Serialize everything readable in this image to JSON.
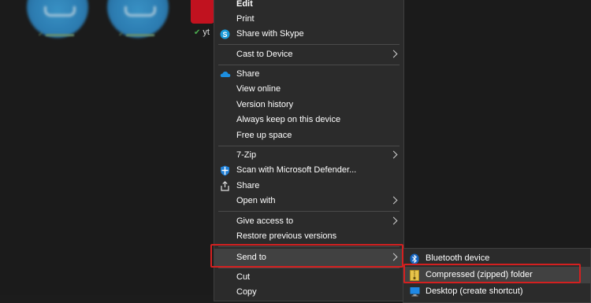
{
  "desktop": {
    "selected_icon_label": "yt",
    "sync_status_icon": "check-icon"
  },
  "menu": {
    "items": [
      {
        "label": "Edit",
        "bold": true
      },
      {
        "label": "Print"
      },
      {
        "label": "Share with Skype",
        "icon": "skype-icon"
      },
      {
        "label": "Cast to Device",
        "submenu": true
      },
      {
        "label": "Share",
        "icon": "onedrive-cloud-icon"
      },
      {
        "label": "View online"
      },
      {
        "label": "Version history"
      },
      {
        "label": "Always keep on this device"
      },
      {
        "label": "Free up space"
      },
      {
        "label": "7-Zip",
        "submenu": true
      },
      {
        "label": "Scan with Microsoft Defender...",
        "icon": "defender-shield-icon"
      },
      {
        "label": "Share",
        "icon": "share-icon"
      },
      {
        "label": "Open with",
        "submenu": true
      },
      {
        "label": "Give access to",
        "submenu": true
      },
      {
        "label": "Restore previous versions"
      },
      {
        "label": "Send to",
        "submenu": true,
        "highlighted": true
      },
      {
        "label": "Cut"
      },
      {
        "label": "Copy"
      }
    ]
  },
  "send_to_submenu": {
    "items": [
      {
        "label": "Bluetooth device",
        "icon": "bluetooth-icon"
      },
      {
        "label": "Compressed (zipped) folder",
        "icon": "zip-folder-icon",
        "highlighted": true
      },
      {
        "label": "Desktop (create shortcut)",
        "icon": "desktop-icon"
      }
    ]
  },
  "colors": {
    "menu_bg": "#2b2b2b",
    "hover_bg": "#414141",
    "highlight_border": "#d42020",
    "accent_blue": "#0a7bd6"
  }
}
